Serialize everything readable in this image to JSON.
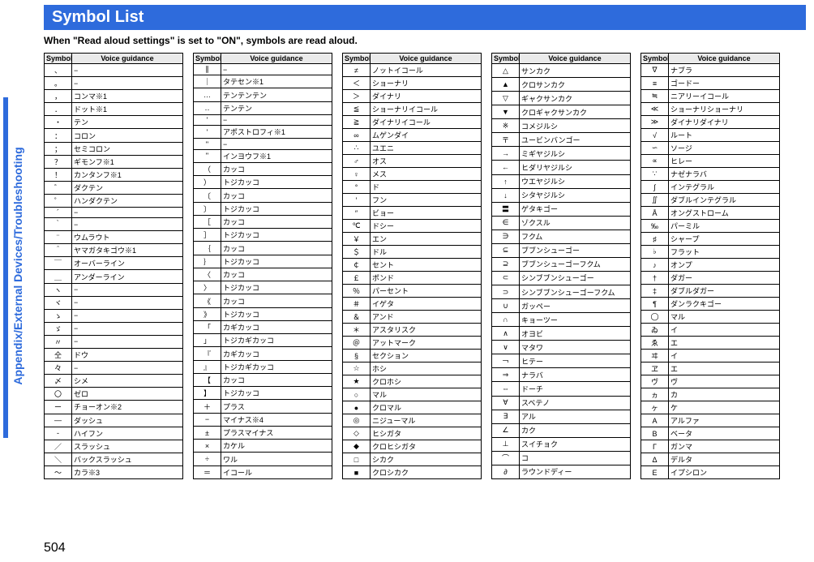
{
  "side_label": "Appendix/External Devices/Troubleshooting",
  "title": "Symbol List",
  "subtitle": "When \"Read aloud settings\" is set to \"ON\", symbols are read aloud.",
  "page_number": "504",
  "headers": {
    "symbol": "Symbol",
    "voice": "Voice guidance"
  },
  "columns": [
    [
      {
        "s": "、",
        "v": "−"
      },
      {
        "s": "。",
        "v": "−"
      },
      {
        "s": "，",
        "v": "コンマ※1"
      },
      {
        "s": "．",
        "v": "ドット※1"
      },
      {
        "s": "・",
        "v": "テン"
      },
      {
        "s": "：",
        "v": "コロン"
      },
      {
        "s": "；",
        "v": "セミコロン"
      },
      {
        "s": "？",
        "v": "ギモンフ※1"
      },
      {
        "s": "！",
        "v": "カンタンフ※1"
      },
      {
        "s": "゛",
        "v": "ダクテン"
      },
      {
        "s": "゜",
        "v": "ハンダクテン"
      },
      {
        "s": "´",
        "v": "−"
      },
      {
        "s": "｀",
        "v": "−"
      },
      {
        "s": "¨",
        "v": "ウムラウト"
      },
      {
        "s": "＾",
        "v": "ヤマガタキゴウ※1"
      },
      {
        "s": "￣",
        "v": "オーバーライン"
      },
      {
        "s": "＿",
        "v": "アンダーライン"
      },
      {
        "s": "ヽ",
        "v": "−"
      },
      {
        "s": "ヾ",
        "v": "−"
      },
      {
        "s": "ゝ",
        "v": "−"
      },
      {
        "s": "ゞ",
        "v": "−"
      },
      {
        "s": "〃",
        "v": "−"
      },
      {
        "s": "仝",
        "v": "ドウ"
      },
      {
        "s": "々",
        "v": "−"
      },
      {
        "s": "〆",
        "v": "シメ"
      },
      {
        "s": "〇",
        "v": "ゼロ"
      },
      {
        "s": "ー",
        "v": "チョーオン※2"
      },
      {
        "s": "―",
        "v": "ダッシュ"
      },
      {
        "s": "‐",
        "v": "ハイフン"
      },
      {
        "s": "／",
        "v": "スラッシュ"
      },
      {
        "s": "＼",
        "v": "バックスラッシュ"
      },
      {
        "s": "〜",
        "v": "カラ※3"
      }
    ],
    [
      {
        "s": "∥",
        "v": "−"
      },
      {
        "s": "｜",
        "v": "タテセン※1"
      },
      {
        "s": "…",
        "v": "テンテンテン"
      },
      {
        "s": "‥",
        "v": "テンテン"
      },
      {
        "s": "'",
        "v": "−"
      },
      {
        "s": "'",
        "v": "アポストロフィ※1"
      },
      {
        "s": "\"",
        "v": "−"
      },
      {
        "s": "\"",
        "v": "インヨウフ※1"
      },
      {
        "s": "（",
        "v": "カッコ"
      },
      {
        "s": "）",
        "v": "トジカッコ"
      },
      {
        "s": "〔",
        "v": "カッコ"
      },
      {
        "s": "〕",
        "v": "トジカッコ"
      },
      {
        "s": "［",
        "v": "カッコ"
      },
      {
        "s": "］",
        "v": "トジカッコ"
      },
      {
        "s": "｛",
        "v": "カッコ"
      },
      {
        "s": "｝",
        "v": "トジカッコ"
      },
      {
        "s": "〈",
        "v": "カッコ"
      },
      {
        "s": "〉",
        "v": "トジカッコ"
      },
      {
        "s": "《",
        "v": "カッコ"
      },
      {
        "s": "》",
        "v": "トジカッコ"
      },
      {
        "s": "「",
        "v": "カギカッコ"
      },
      {
        "s": "」",
        "v": "トジカギカッコ"
      },
      {
        "s": "『",
        "v": "カギカッコ"
      },
      {
        "s": "』",
        "v": "トジカギカッコ"
      },
      {
        "s": "【",
        "v": "カッコ"
      },
      {
        "s": "】",
        "v": "トジカッコ"
      },
      {
        "s": "＋",
        "v": "プラス"
      },
      {
        "s": "−",
        "v": "マイナス※4"
      },
      {
        "s": "±",
        "v": "プラスマイナス"
      },
      {
        "s": "×",
        "v": "カケル"
      },
      {
        "s": "÷",
        "v": "ワル"
      },
      {
        "s": "＝",
        "v": "イコール"
      }
    ],
    [
      {
        "s": "≠",
        "v": "ノットイコール"
      },
      {
        "s": "＜",
        "v": "ショーナリ"
      },
      {
        "s": "＞",
        "v": "ダイナリ"
      },
      {
        "s": "≦",
        "v": "ショーナリイコール"
      },
      {
        "s": "≧",
        "v": "ダイナリイコール"
      },
      {
        "s": "∞",
        "v": "ムゲンダイ"
      },
      {
        "s": "∴",
        "v": "ユエニ"
      },
      {
        "s": "♂",
        "v": "オス"
      },
      {
        "s": "♀",
        "v": "メス"
      },
      {
        "s": "°",
        "v": "ド"
      },
      {
        "s": "′",
        "v": "フン"
      },
      {
        "s": "″",
        "v": "ビョー"
      },
      {
        "s": "℃",
        "v": "ドシー"
      },
      {
        "s": "￥",
        "v": "エン"
      },
      {
        "s": "＄",
        "v": "ドル"
      },
      {
        "s": "￠",
        "v": "セント"
      },
      {
        "s": "￡",
        "v": "ポンド"
      },
      {
        "s": "％",
        "v": "パーセント"
      },
      {
        "s": "＃",
        "v": "イゲタ"
      },
      {
        "s": "＆",
        "v": "アンド"
      },
      {
        "s": "＊",
        "v": "アスタリスク"
      },
      {
        "s": "＠",
        "v": "アットマーク"
      },
      {
        "s": "§",
        "v": "セクション"
      },
      {
        "s": "☆",
        "v": "ホシ"
      },
      {
        "s": "★",
        "v": "クロホシ"
      },
      {
        "s": "○",
        "v": "マル"
      },
      {
        "s": "●",
        "v": "クロマル"
      },
      {
        "s": "◎",
        "v": "ニジューマル"
      },
      {
        "s": "◇",
        "v": "ヒシガタ"
      },
      {
        "s": "◆",
        "v": "クロヒシガタ"
      },
      {
        "s": "□",
        "v": "シカク"
      },
      {
        "s": "■",
        "v": "クロシカク"
      }
    ],
    [
      {
        "s": "△",
        "v": "サンカク"
      },
      {
        "s": "▲",
        "v": "クロサンカク"
      },
      {
        "s": "▽",
        "v": "ギャクサンカク"
      },
      {
        "s": "▼",
        "v": "クロギャクサンカク"
      },
      {
        "s": "※",
        "v": "コメジルシ"
      },
      {
        "s": "〒",
        "v": "ユービンバンゴー"
      },
      {
        "s": "→",
        "v": "ミギヤジルシ"
      },
      {
        "s": "←",
        "v": "ヒダリヤジルシ"
      },
      {
        "s": "↑",
        "v": "ウエヤジルシ"
      },
      {
        "s": "↓",
        "v": "シタヤジルシ"
      },
      {
        "s": "〓",
        "v": "ゲタキゴー"
      },
      {
        "s": "∈",
        "v": "ゾクスル"
      },
      {
        "s": "∋",
        "v": "フクム"
      },
      {
        "s": "⊆",
        "v": "ブブンシューゴー"
      },
      {
        "s": "⊇",
        "v": "ブブンシューゴーフクム"
      },
      {
        "s": "⊂",
        "v": "シンブブンシューゴー"
      },
      {
        "s": "⊃",
        "v": "シンブブンシューゴーフクム"
      },
      {
        "s": "∪",
        "v": "ガッペー"
      },
      {
        "s": "∩",
        "v": "キョーツー"
      },
      {
        "s": "∧",
        "v": "オヨビ"
      },
      {
        "s": "∨",
        "v": "マタワ"
      },
      {
        "s": "￢",
        "v": "ヒテー"
      },
      {
        "s": "⇒",
        "v": "ナラバ"
      },
      {
        "s": "⇔",
        "v": "ドーチ"
      },
      {
        "s": "∀",
        "v": "スベテノ"
      },
      {
        "s": "∃",
        "v": "アル"
      },
      {
        "s": "∠",
        "v": "カク"
      },
      {
        "s": "⊥",
        "v": "スイチョク"
      },
      {
        "s": "⌒",
        "v": "コ"
      },
      {
        "s": "∂",
        "v": "ラウンドディー"
      }
    ],
    [
      {
        "s": "∇",
        "v": "ナブラ"
      },
      {
        "s": "≡",
        "v": "ゴードー"
      },
      {
        "s": "≒",
        "v": "ニアリーイコール"
      },
      {
        "s": "≪",
        "v": "ショーナリショーナリ"
      },
      {
        "s": "≫",
        "v": "ダイナリダイナリ"
      },
      {
        "s": "√",
        "v": "ルート"
      },
      {
        "s": "∽",
        "v": "ソージ"
      },
      {
        "s": "∝",
        "v": "ヒレー"
      },
      {
        "s": "∵",
        "v": "ナゼナラバ"
      },
      {
        "s": "∫",
        "v": "インテグラル"
      },
      {
        "s": "∬",
        "v": "ダブルインテグラル"
      },
      {
        "s": "Å",
        "v": "オングストローム"
      },
      {
        "s": "‰",
        "v": "パーミル"
      },
      {
        "s": "♯",
        "v": "シャープ"
      },
      {
        "s": "♭",
        "v": "フラット"
      },
      {
        "s": "♪",
        "v": "オンプ"
      },
      {
        "s": "†",
        "v": "ダガー"
      },
      {
        "s": "‡",
        "v": "ダブルダガー"
      },
      {
        "s": "¶",
        "v": "ダンラクキゴー"
      },
      {
        "s": "◯",
        "v": "マル"
      },
      {
        "s": "ゐ",
        "v": "イ"
      },
      {
        "s": "ゑ",
        "v": "エ"
      },
      {
        "s": "ヰ",
        "v": "イ"
      },
      {
        "s": "ヱ",
        "v": "エ"
      },
      {
        "s": "ヴ",
        "v": "ヴ"
      },
      {
        "s": "ヵ",
        "v": "カ"
      },
      {
        "s": "ヶ",
        "v": "ケ"
      },
      {
        "s": "Α",
        "v": "アルファ"
      },
      {
        "s": "Β",
        "v": "ベータ"
      },
      {
        "s": "Γ",
        "v": "ガンマ"
      },
      {
        "s": "Δ",
        "v": "デルタ"
      },
      {
        "s": "Ε",
        "v": "イプシロン"
      }
    ]
  ]
}
